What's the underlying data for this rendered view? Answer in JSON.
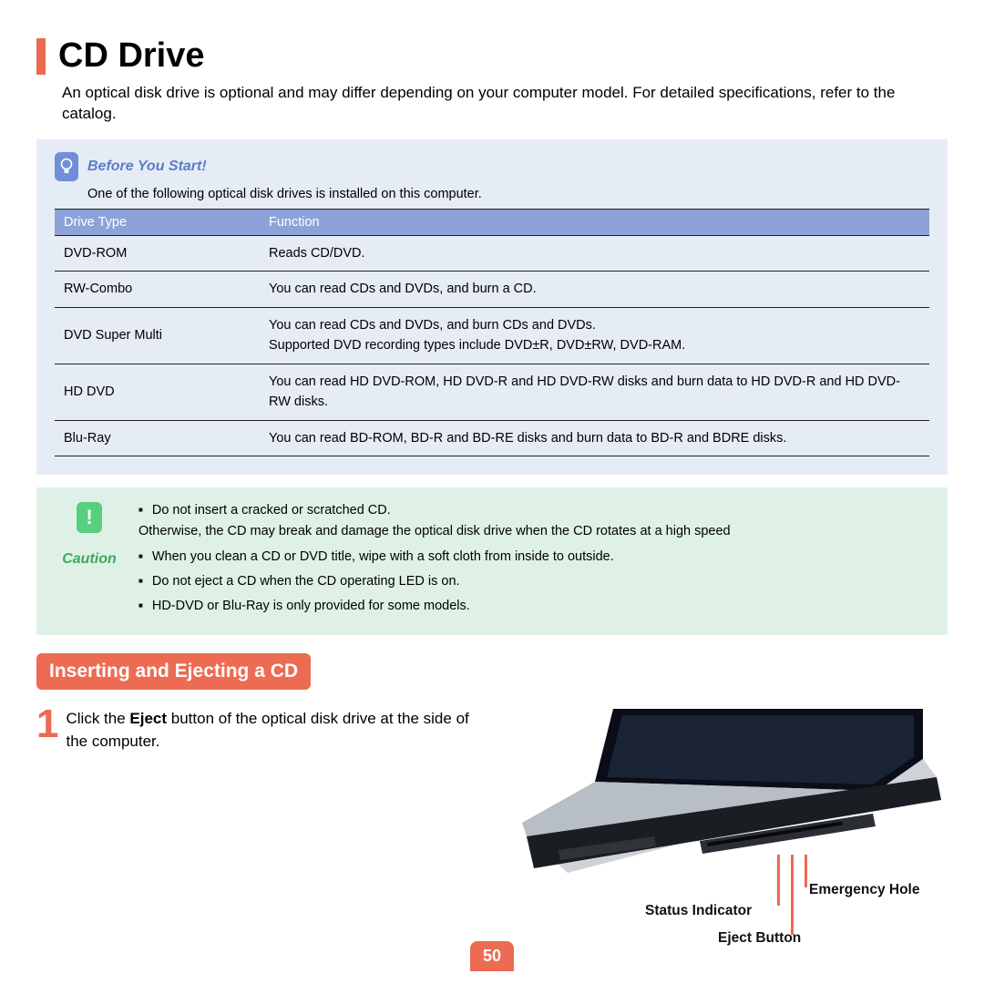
{
  "title": "CD Drive",
  "intro": "An optical disk drive is optional and may differ depending on your computer model. For detailed specifications, refer to the catalog.",
  "info": {
    "heading": "Before You Start!",
    "sub": "One of the following optical disk drives is installed on this computer.",
    "cols": {
      "type": "Drive Type",
      "func": "Function"
    },
    "rows": [
      {
        "type": "DVD-ROM",
        "func": "Reads CD/DVD."
      },
      {
        "type": "RW-Combo",
        "func": "You can read CDs and DVDs, and burn a CD."
      },
      {
        "type": "DVD Super Multi",
        "func": "You can read CDs and DVDs, and burn CDs and DVDs.\nSupported DVD recording types include DVD±R, DVD±RW, DVD-RAM."
      },
      {
        "type": "HD DVD",
        "func": "You can read HD DVD-ROM, HD DVD-R and HD DVD-RW disks and burn data to HD DVD-R and HD DVD-RW disks."
      },
      {
        "type": "Blu-Ray",
        "func": "You can read BD-ROM, BD-R and BD-RE disks and burn data to BD-R and BDRE disks."
      }
    ]
  },
  "caution": {
    "label": "Caution",
    "items": [
      "Do not insert a cracked or scratched CD.\nOtherwise, the CD may break and damage the optical disk drive when the CD rotates at a high speed",
      "When you clean a CD or DVD title, wipe with a soft cloth from inside to outside.",
      "Do not eject a CD when the CD operating LED is on.",
      "HD-DVD or Blu-Ray is only provided for some models."
    ]
  },
  "section": "Inserting and Ejecting a CD",
  "step": {
    "num": "1",
    "pre": "Click the ",
    "bold": "Eject",
    "post": " button of the optical disk drive at the side of the computer."
  },
  "callouts": {
    "status": "Status Indicator",
    "emergency": "Emergency Hole",
    "eject": "Eject Button"
  },
  "page": "50"
}
